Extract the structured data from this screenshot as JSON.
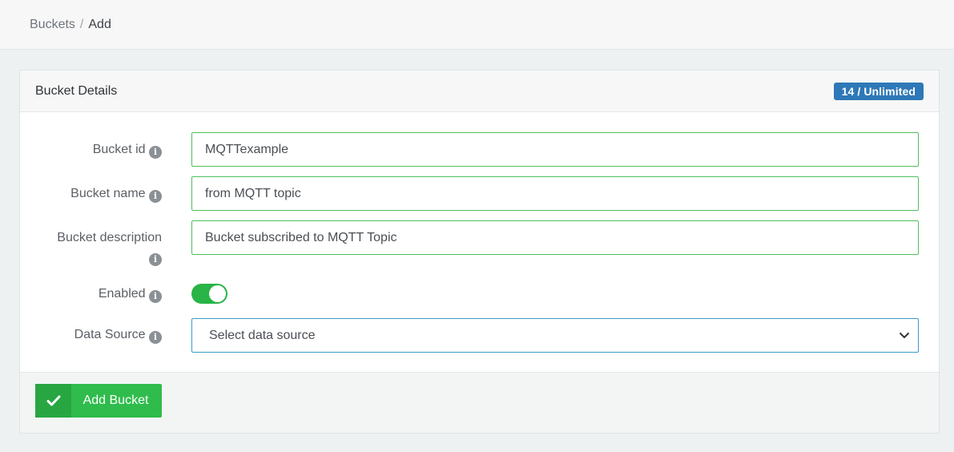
{
  "breadcrumb": {
    "items": [
      {
        "label": "Buckets"
      },
      {
        "label": "Add"
      }
    ],
    "separator": "/"
  },
  "card": {
    "title": "Bucket Details",
    "quota_badge": "14 / Unlimited"
  },
  "form": {
    "bucket_id": {
      "label": "Bucket id",
      "value": "MQTTexample",
      "info_icon": "info-circle-icon"
    },
    "bucket_name": {
      "label": "Bucket name",
      "value": "from MQTT topic",
      "info_icon": "info-circle-icon"
    },
    "bucket_description": {
      "label": "Bucket description",
      "value": "Bucket subscribed to MQTT Topic",
      "info_icon": "info-circle-icon"
    },
    "enabled": {
      "label": "Enabled",
      "checked": true,
      "info_icon": "info-circle-icon"
    },
    "data_source": {
      "label": "Data Source",
      "selected": "Select data source",
      "info_icon": "info-circle-icon"
    }
  },
  "footer": {
    "add_button_label": "Add Bucket",
    "add_button_icon": "check-icon"
  },
  "colors": {
    "accent_green": "#2fbc4c",
    "badge_blue": "#2e78b7",
    "select_border": "#3d9bc9",
    "input_border": "#4fbf5f"
  }
}
